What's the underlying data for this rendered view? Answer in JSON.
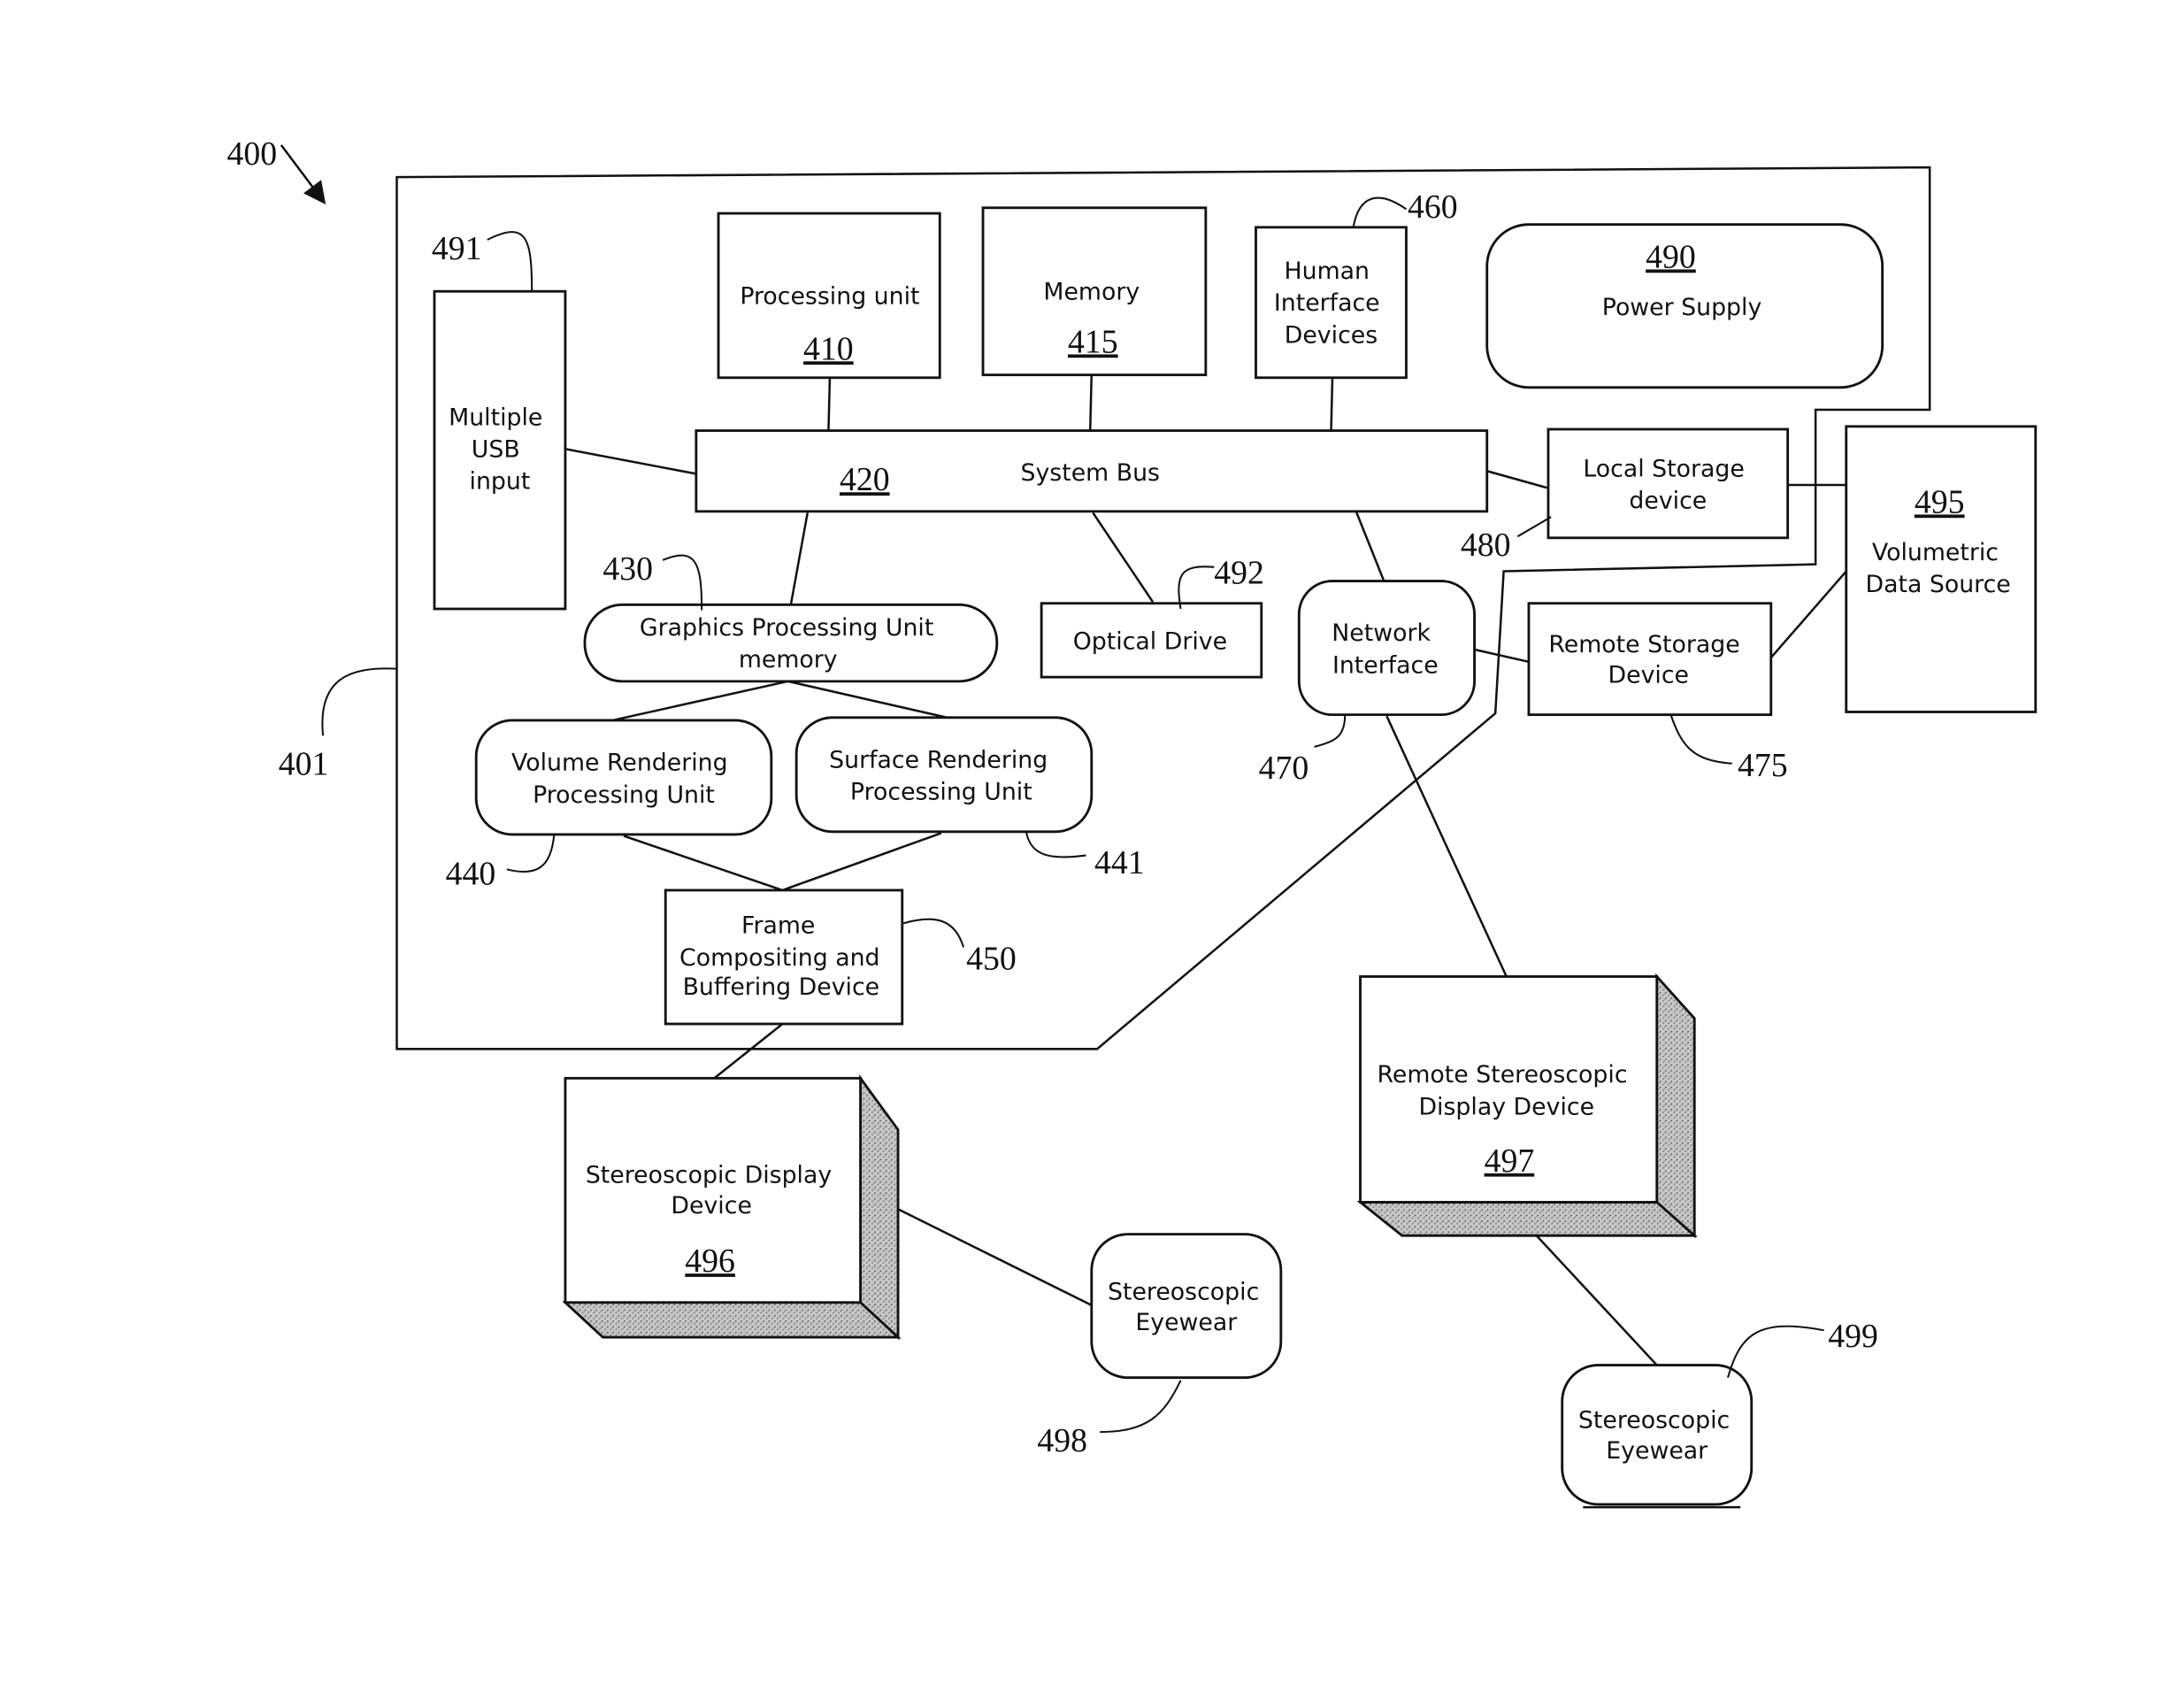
{
  "figure": {
    "ref": "400",
    "enclosure_ref": "401"
  },
  "components": {
    "usb": {
      "label_lines": [
        "Multiple",
        "USB",
        "input"
      ],
      "ref": "491"
    },
    "processing_unit": {
      "label": "Processing unit",
      "ref": "410"
    },
    "memory": {
      "label": "Memory",
      "ref": "415"
    },
    "hid": {
      "label_lines": [
        "Human",
        "Interface",
        "Devices"
      ],
      "ref": "460"
    },
    "power_supply": {
      "label": "Power Supply",
      "ref": "490"
    },
    "system_bus": {
      "label": "System Bus",
      "ref": "420"
    },
    "local_storage": {
      "label_lines": [
        "Local Storage",
        "device"
      ],
      "ref": "480"
    },
    "volumetric_source": {
      "label_lines": [
        "Volumetric",
        "Data Source"
      ],
      "ref": "495"
    },
    "gpu_memory": {
      "label_lines": [
        "Graphics Processing Unit",
        "memory"
      ],
      "ref": "430"
    },
    "optical_drive": {
      "label": "Optical Drive",
      "ref": "492"
    },
    "network_interface": {
      "label_lines": [
        "Network",
        "Interface"
      ],
      "ref": "470"
    },
    "remote_storage": {
      "label_lines": [
        "Remote Storage",
        "Device"
      ],
      "ref": "475"
    },
    "volume_rendering": {
      "label_lines": [
        "Volume Rendering",
        "Processing Unit"
      ],
      "ref": "440"
    },
    "surface_rendering": {
      "label_lines": [
        "Surface Rendering",
        "Processing Unit"
      ],
      "ref": "441"
    },
    "frame_compositing": {
      "label_lines": [
        "Frame",
        "Compositing and",
        "Buffering Device"
      ],
      "ref": "450"
    },
    "stereo_display": {
      "label_lines": [
        "Stereoscopic Display",
        "Device"
      ],
      "ref": "496"
    },
    "remote_stereo_display": {
      "label_lines": [
        "Remote Stereoscopic",
        "Display Device"
      ],
      "ref": "497"
    },
    "eyewear_local": {
      "label_lines": [
        "Stereoscopic",
        "Eyewear"
      ],
      "ref": "498"
    },
    "eyewear_remote": {
      "label_lines": [
        "Stereoscopic",
        "Eyewear"
      ],
      "ref": "499"
    }
  }
}
